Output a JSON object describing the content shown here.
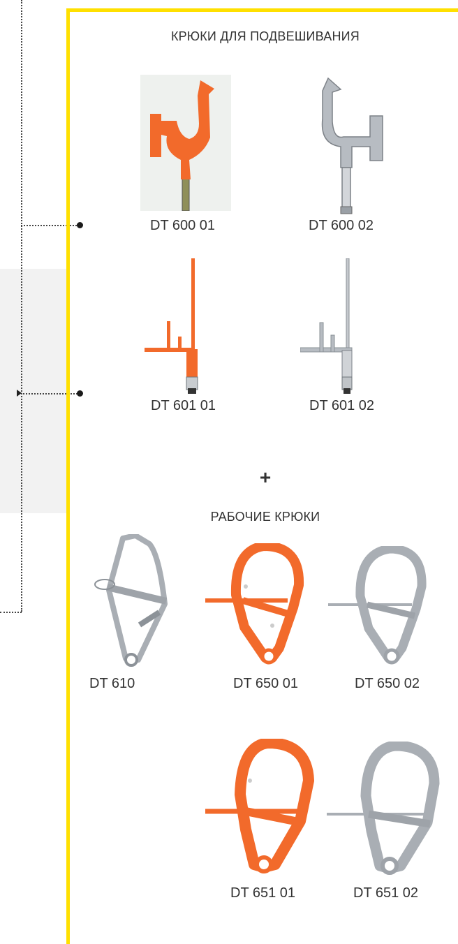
{
  "sections": {
    "suspension_title": "КРЮКИ ДЛЯ ПОДВЕШИВАНИЯ",
    "plus": "+",
    "working_title": "РАБОЧИЕ КРЮКИ"
  },
  "suspension_hooks": [
    {
      "code": "DT 600 01",
      "color": "#f26a2b"
    },
    {
      "code": "DT 600 02",
      "color": "#b7bcc2"
    },
    {
      "code": "DT 601 01",
      "color": "#f26a2b"
    },
    {
      "code": "DT 601 02",
      "color": "#b7bcc2"
    }
  ],
  "working_hooks": [
    {
      "code": "DT 610",
      "color": "#b7bcc2"
    },
    {
      "code": "DT 650 01",
      "color": "#f26a2b"
    },
    {
      "code": "DT 650 02",
      "color": "#b7bcc2"
    },
    {
      "code": "DT 651 01",
      "color": "#f26a2b"
    },
    {
      "code": "DT 651 02",
      "color": "#b7bcc2"
    }
  ],
  "colors": {
    "accent_frame": "#ffe000",
    "orange": "#f26a2b",
    "steel": "#b7bcc2"
  }
}
